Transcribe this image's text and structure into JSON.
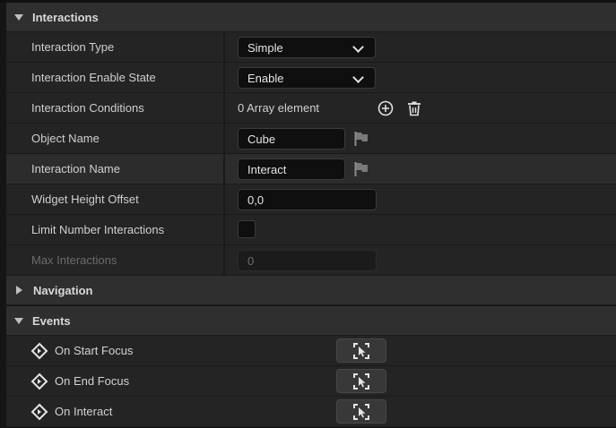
{
  "sections": {
    "interactions": "Interactions",
    "navigation": "Navigation",
    "events": "Events"
  },
  "props": {
    "interaction_type": {
      "label": "Interaction Type",
      "value": "Simple"
    },
    "interaction_enable_state": {
      "label": "Interaction Enable State",
      "value": "Enable"
    },
    "interaction_conditions": {
      "label": "Interaction Conditions",
      "value": "0 Array element"
    },
    "object_name": {
      "label": "Object Name",
      "value": "Cube"
    },
    "interaction_name": {
      "label": "Interaction Name",
      "value": "Interact"
    },
    "widget_height_offset": {
      "label": "Widget Height Offset",
      "value": "0,0"
    },
    "limit_number_interactions": {
      "label": "Limit Number Interactions",
      "checked": false
    },
    "max_interactions": {
      "label": "Max Interactions",
      "value": "0"
    }
  },
  "events": [
    {
      "label": "On Start Focus"
    },
    {
      "label": "On End Focus"
    },
    {
      "label": "On Interact"
    }
  ],
  "icons": {
    "combo": "chevron-down-icon",
    "add": "plus-circle-icon",
    "delete": "trash-icon",
    "localize": "flag-icon",
    "event": "event-diamond-icon",
    "bind": "bind-cursor-icon"
  }
}
